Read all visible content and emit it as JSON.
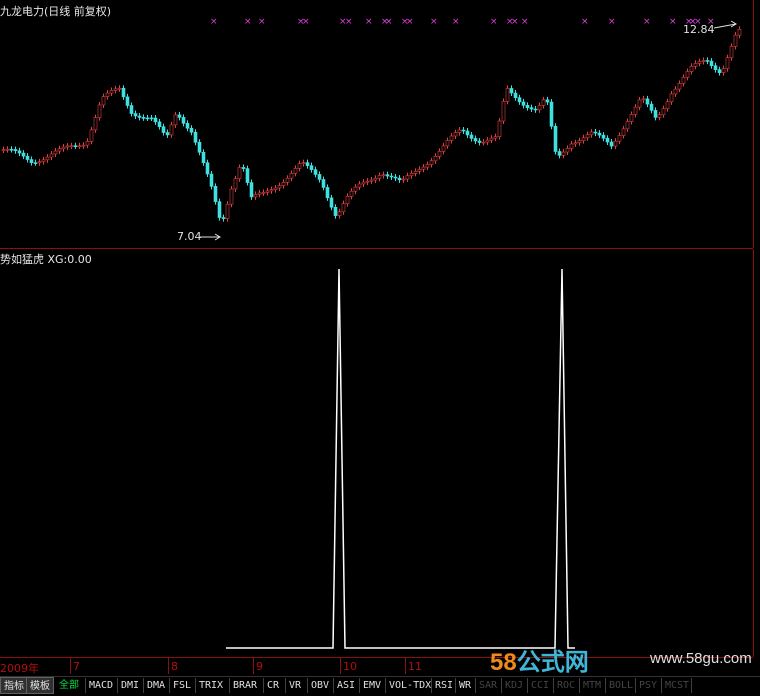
{
  "main_panel": {
    "title": "九龙电力(日线 前复权)",
    "high_label": "12.84",
    "low_label": "7.04",
    "colors": {
      "up": "#e04040",
      "down": "#40e0e0",
      "signal": "#e040e0",
      "border": "#8a1010"
    }
  },
  "indicator_panel": {
    "title": "势如猛虎 XG:0.00",
    "line_color": "#ffffff"
  },
  "axis": {
    "labels": [
      "2009年",
      "7",
      "8",
      "9",
      "10",
      "11"
    ]
  },
  "tabs": [
    "指标",
    "模板",
    "全部",
    "MACD",
    "DMI",
    "DMA",
    "FSL",
    "TRIX",
    "BRAR",
    "CR",
    "VR",
    "OBV",
    "ASI",
    "EMV",
    "VOL-TDX",
    "RSI",
    "WR",
    "SAR",
    "KDJ",
    "CCI",
    "ROC",
    "MTM",
    "BOLL",
    "PSY",
    "MCST"
  ],
  "selected_tab": "全部",
  "watermark": {
    "logo_num": "58",
    "logo_text": "公式网",
    "url": "www.58gu.com"
  }
}
